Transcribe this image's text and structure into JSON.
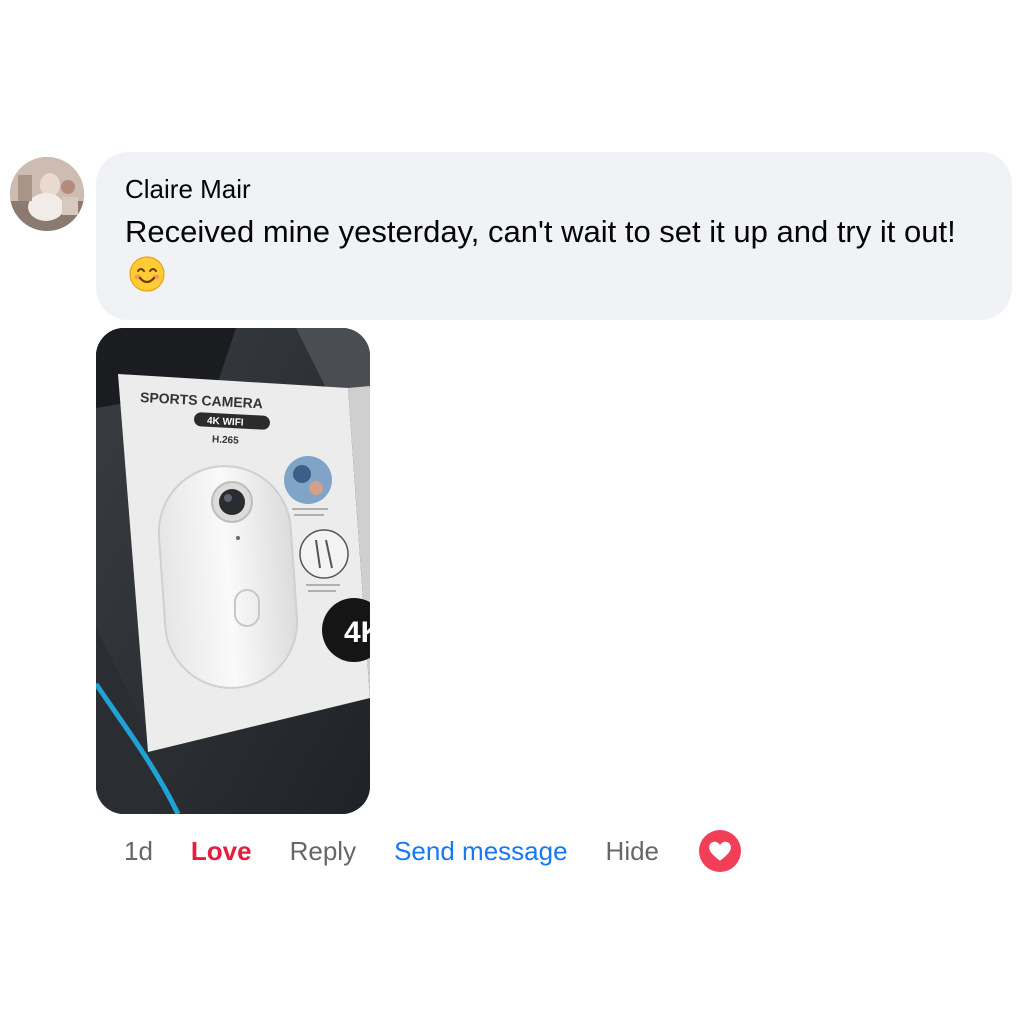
{
  "comment": {
    "author": "Claire Mair",
    "text": "Received mine yesterday, can't wait to set it up and try it out!",
    "emoji": "smiling-face-with-smiling-eyes-icon",
    "photo": {
      "box_title": "SPORTS CAMERA",
      "box_badge": "4K WIFI",
      "box_codec": "H.265",
      "box_logo": "4K"
    }
  },
  "actions": {
    "time": "1d",
    "love": "Love",
    "reply": "Reply",
    "send_message": "Send message",
    "hide": "Hide",
    "reaction_icon": "love-reaction-icon"
  },
  "colors": {
    "bubble": "#f0f2f5",
    "love": "#e41e3f",
    "link": "#1877f2",
    "meta": "#65676b",
    "reaction": "#f33e58"
  }
}
